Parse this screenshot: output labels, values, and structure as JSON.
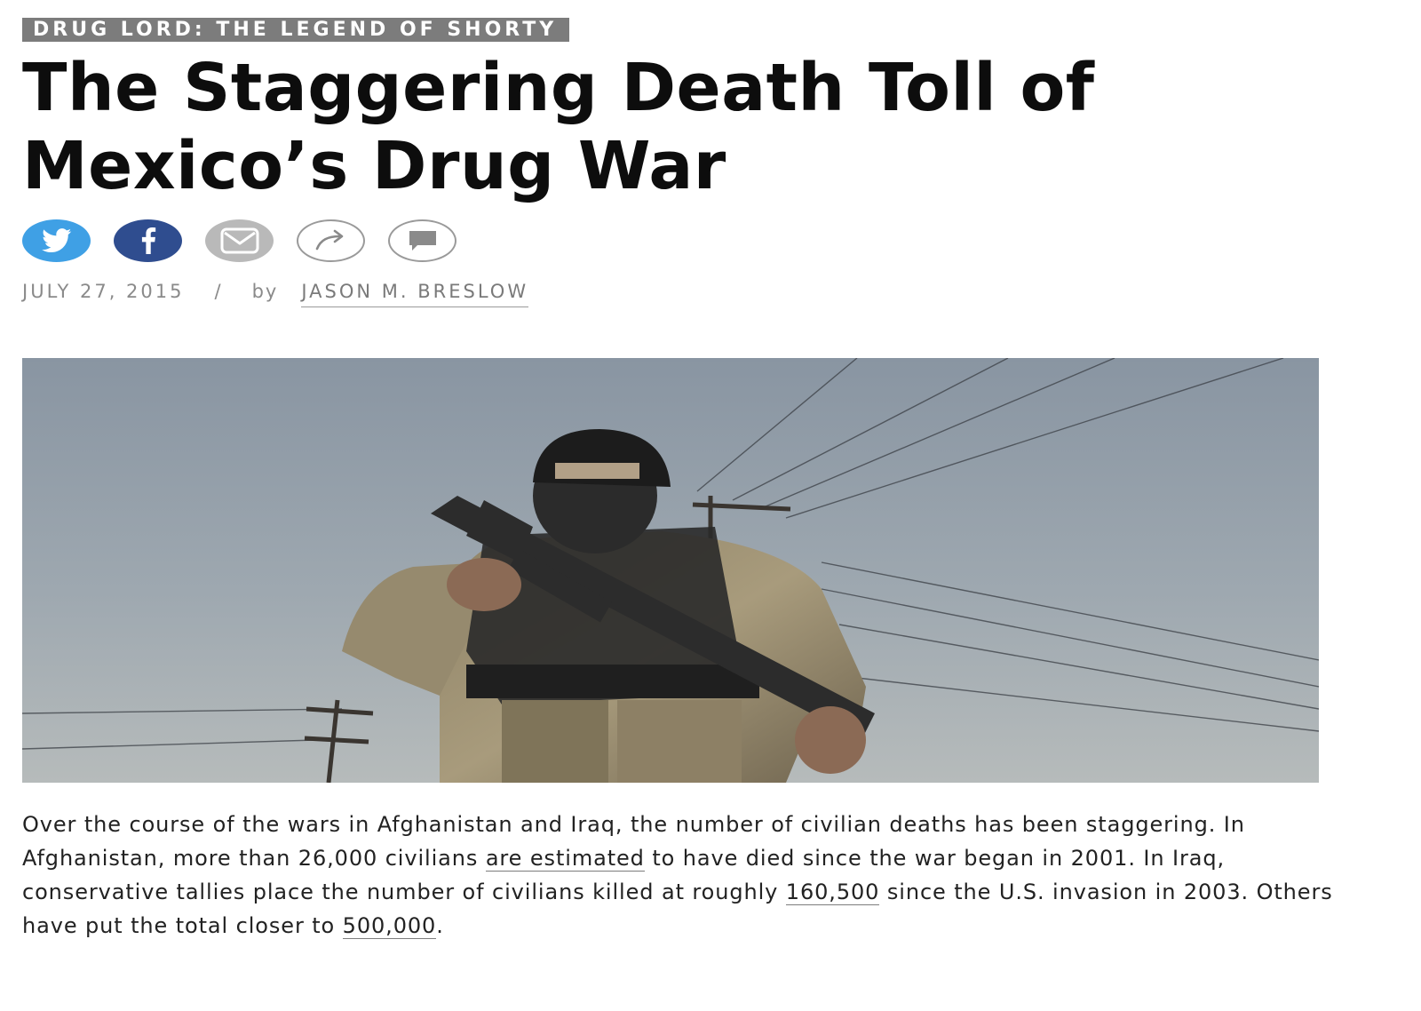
{
  "article": {
    "kicker": "DRUG LORD: THE LEGEND OF SHORTY",
    "headline_line1": "The Staggering Death Toll of",
    "headline_line2": "Mexico’s Drug War",
    "date": "JULY 27, 2015",
    "separator": "/",
    "by": "by",
    "author": "JASON M. BRESLOW",
    "paragraph": {
      "t1": "Over the course of the wars in Afghanistan and Iraq, the number of civilian deaths has been staggering. In Afghanistan, more than 26,000 civilians ",
      "link1": "are estimated",
      "t2": " to have died since the war began in 2001. In Iraq, conservative tallies place the number of civilians killed at roughly ",
      "link2": "160,500",
      "t3": " since the U.S. invasion in 2003. Others have put the total closer to ",
      "link3": "500,000",
      "t4": "."
    }
  },
  "share": {
    "buttons": [
      "twitter-icon",
      "facebook-icon",
      "email-icon",
      "share-arrow-icon",
      "comment-icon"
    ]
  },
  "colors": {
    "twitter": "#3fa0e5",
    "facebook": "#2f4d8f",
    "email": "#b9b9b9",
    "kicker_bg": "#7c7c7c",
    "meta_text": "#8a8a8a"
  }
}
